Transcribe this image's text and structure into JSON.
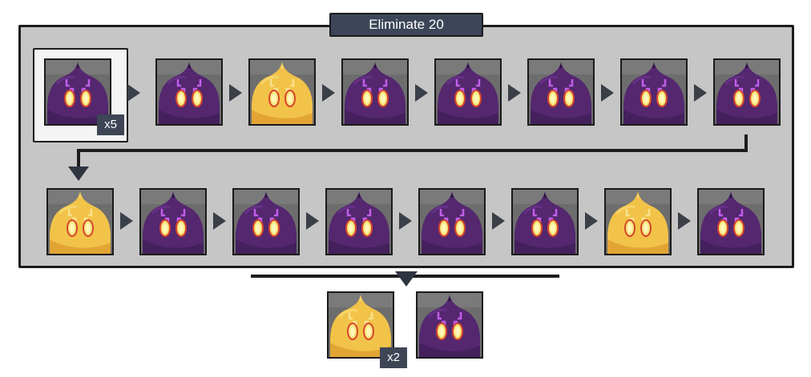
{
  "header": {
    "title": "Eliminate 20"
  },
  "sequence": {
    "row1": [
      {
        "type": "purple",
        "count_label": "x5"
      },
      {
        "type": "purple"
      },
      {
        "type": "yellow"
      },
      {
        "type": "purple"
      },
      {
        "type": "purple"
      },
      {
        "type": "purple"
      },
      {
        "type": "purple"
      },
      {
        "type": "purple"
      }
    ],
    "row2": [
      {
        "type": "yellow"
      },
      {
        "type": "purple"
      },
      {
        "type": "purple"
      },
      {
        "type": "purple"
      },
      {
        "type": "purple"
      },
      {
        "type": "purple"
      },
      {
        "type": "yellow"
      },
      {
        "type": "purple"
      }
    ]
  },
  "result": [
    {
      "type": "yellow",
      "count_label": "x2"
    },
    {
      "type": "purple"
    }
  ],
  "colors": {
    "panel_bg": "#c6c6c6",
    "tab_bg": "#3c4658",
    "purple_slime": "#5a2a7a",
    "yellow_slime": "#f0c040",
    "badge_bg": "#3e4656"
  },
  "icons": {
    "purple": "purple-slime-icon",
    "yellow": "yellow-slime-icon",
    "arrow": "right-arrow-icon"
  }
}
